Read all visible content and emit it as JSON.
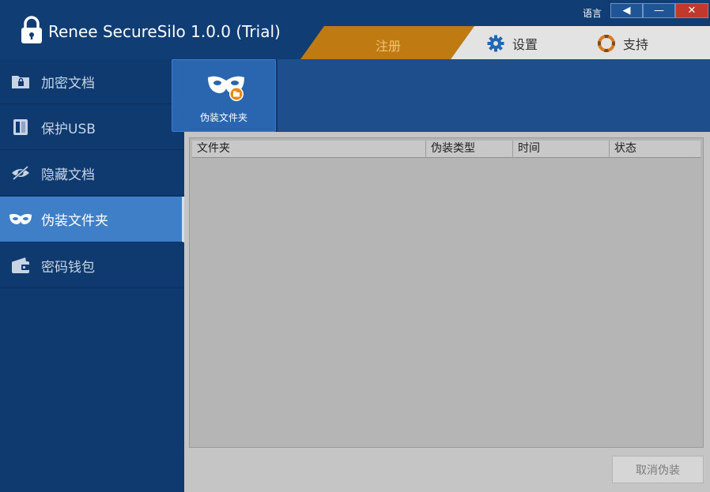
{
  "app": {
    "title": "Renee SecureSilo 1.0.0 (Trial)"
  },
  "window_controls": {
    "language_label": "语言",
    "language_button": "◀",
    "minimize": "—",
    "close": "✕"
  },
  "top_tabs": {
    "register": "注册",
    "settings": "设置",
    "support": "支持"
  },
  "sidebar": {
    "items": [
      {
        "label": "加密文档",
        "icon": "encrypted-folder-icon"
      },
      {
        "label": "保护USB",
        "icon": "usb-drive-icon"
      },
      {
        "label": "隐藏文档",
        "icon": "eye-slash-icon"
      },
      {
        "label": "伪装文件夹",
        "icon": "mask-icon",
        "active": true
      },
      {
        "label": "密码钱包",
        "icon": "wallet-icon"
      }
    ]
  },
  "toolbar": {
    "disguise_folder": "伪装文件夹"
  },
  "table": {
    "columns": [
      "文件夹",
      "伪装类型",
      "时间",
      "状态"
    ],
    "rows": []
  },
  "actions": {
    "cancel_disguise": "取消伪装"
  },
  "colors": {
    "sidebar_bg": "#0e3a6f",
    "active_item": "#3e7fc8",
    "register_tab": "#c07a12",
    "close_button": "#c0392b",
    "accent_orange": "#e58b12"
  }
}
